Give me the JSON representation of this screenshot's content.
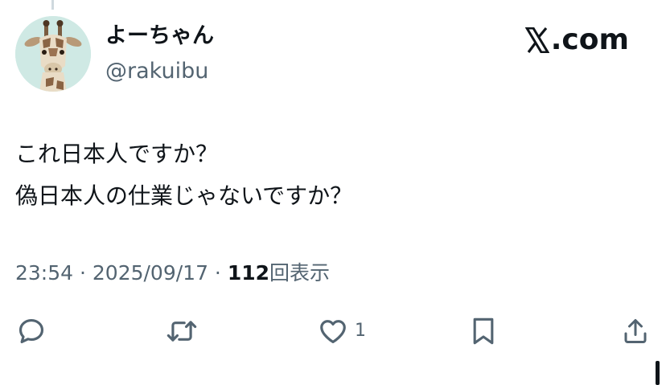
{
  "author": {
    "display_name": "よーちゃん",
    "handle": "@rakuibu"
  },
  "brand": {
    "label": ".com"
  },
  "post": {
    "lines": [
      "これ日本人ですか？",
      "偽日本人の仕業じゃないですか？"
    ]
  },
  "meta": {
    "time": "23:54",
    "separator_1": " · ",
    "date": "2025/09/17",
    "separator_2": " · ",
    "views_count": "112",
    "views_label": "回表示"
  },
  "actions": {
    "reply_icon": "reply-icon",
    "repost_icon": "repost-icon",
    "like_icon": "heart-icon",
    "like_count": "1",
    "bookmark_icon": "bookmark-icon",
    "share_icon": "share-icon"
  },
  "colors": {
    "text_primary": "#0f1419",
    "text_secondary": "#536471",
    "avatar_background": "#cfe9e4"
  }
}
